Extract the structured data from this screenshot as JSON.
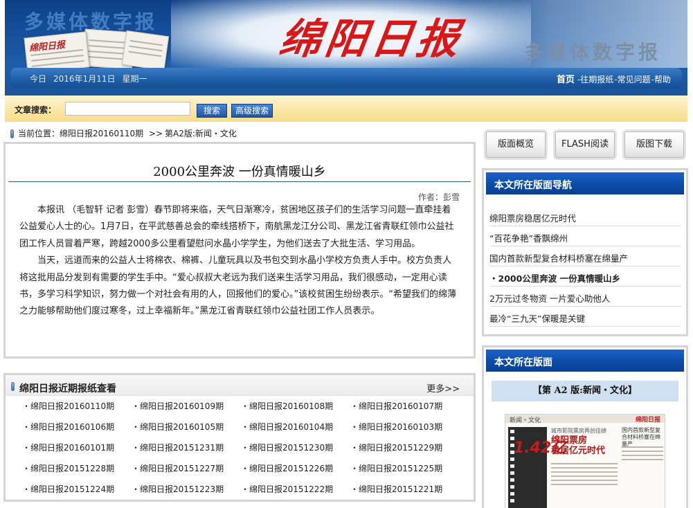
{
  "header": {
    "left_slogan": "多媒体数字报",
    "masthead": "绵阳日报",
    "right_slogan": "多媒体数字报",
    "paper_mastheads": [
      "绵阳日报",
      "绵阳日报"
    ],
    "date_prefix": "今日",
    "date": "2016年1月11日",
    "weekday": "星期一",
    "nav": {
      "home": "首页",
      "past": "-往期报纸",
      "faq": "-常见问题",
      "help": "-帮助"
    }
  },
  "search": {
    "label": "文章搜索：",
    "value": "",
    "placeholder": "",
    "search_button": "搜索",
    "advanced_button": "高级搜索"
  },
  "breadcrumb": {
    "prefix": "当前位置：",
    "issue": "绵阳日报20160110期",
    "separator": ">>",
    "page": "第A2版:新闻・文化"
  },
  "article": {
    "title": "2000公里奔波  一份真情暖山乡",
    "author": "作者：彭雪",
    "paragraphs": [
      "本报讯 （毛智轩 记者 彭雪）春节即将来临，天气日渐寒冷，贫困地区孩子们的生活学习问题一直牵挂着公益爱心人士的心。1月7日，在平武慈善总会的牵线搭桥下，南航黑龙江分公司、黑龙江省青联红领巾公益社团工作人员冒着严寒，跨越2000多公里看望慰问水晶小学学生，为他们送去了大批生活、学习用品。",
      "当天，远道而来的公益人士将棉衣、棉裤、儿童玩具以及书包交到水晶小学校方负责人手中。校方负责人将这批用品分发到有需要的学生手中。“爱心叔叔大老远为我们送来生活学习用品，我们很感动，一定用心读书，多学习科学知识，努力做一个对社会有用的人，回报他们的爱心。”该校贫困生纷纷表示。“希望我们的绵薄之力能够帮助他们度过寒冬，过上幸福新年。”黑龙江省青联红领巾公益社团工作人员表示。"
    ]
  },
  "recent": {
    "title": "绵阳日报近期报纸查看",
    "more": "更多>>",
    "items": [
      "・绵阳日报20160110期",
      "・绵阳日报20160109期",
      "・绵阳日报20160108期",
      "・绵阳日报20160107期",
      "・绵阳日报20160106期",
      "・绵阳日报20160105期",
      "・绵阳日报20160104期",
      "・绵阳日报20160103期",
      "・绵阳日报20160101期",
      "・绵阳日报20151231期",
      "・绵阳日报20151230期",
      "・绵阳日报20151229期",
      "・绵阳日报20151228期",
      "・绵阳日报20151227期",
      "・绵阳日报20151226期",
      "・绵阳日报20151225期",
      "・绵阳日报20151224期",
      "・绵阳日报20151223期",
      "・绵阳日报20151222期",
      "・绵阳日报20151221期"
    ]
  },
  "right": {
    "buttons": [
      "版面概览",
      "FLASH阅读",
      "版图下载"
    ],
    "nav_title": "本文所在版面导航",
    "nav_items": [
      "绵阳票房稳居亿元时代",
      "“百花争艳”香飘绵州",
      "国内首款新型复合材料桥塞在绵量产",
      "・2000公里奔波  一份真情暖山乡",
      "2万元过冬物资  一片爱心助他人",
      "最冷“三九天”保暖是关键"
    ],
    "page_title": "本文所在版面",
    "page_label": "【第 A2 版:新闻・文化】",
    "thumbnail": {
      "section": "新闻・文化",
      "masthead": "绵阳日报",
      "big_number": "1.42亿",
      "headline_1": "绵阳票房",
      "headline_2": "稳居亿元时代",
      "subhead": "城市影院票房再创佳绩",
      "side_text": "国内首款新型复合材料桥塞在绵量产"
    }
  },
  "colors": {
    "header_blue": "#16509a",
    "masthead_red": "#d81818",
    "search_bar": "#fbe7a6",
    "panel_blue": "#0c49a6",
    "panel_border": "#d5d5d5"
  }
}
